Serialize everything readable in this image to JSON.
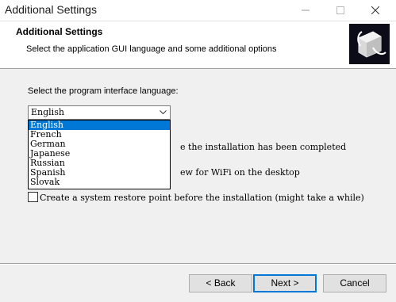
{
  "window": {
    "title": "Additional Settings"
  },
  "header": {
    "title": "Additional Settings",
    "subtitle": "Select the application GUI language and some additional options"
  },
  "language": {
    "label": "Select the program interface language:",
    "selected": "English",
    "options": [
      "English",
      "French",
      "German",
      "Japanese",
      "Russian",
      "Spanish",
      "Slovak"
    ]
  },
  "options": {
    "option1_visible_text": "e the installation has been completed",
    "option2_visible_text": "ew for WiFi on the desktop",
    "restore_point": "Create a system restore point before the installation (might take a while)"
  },
  "buttons": {
    "back": "< Back",
    "next": "Next >",
    "cancel": "Cancel"
  },
  "colors": {
    "accent": "#0078d7",
    "selection": "#0078d7"
  }
}
